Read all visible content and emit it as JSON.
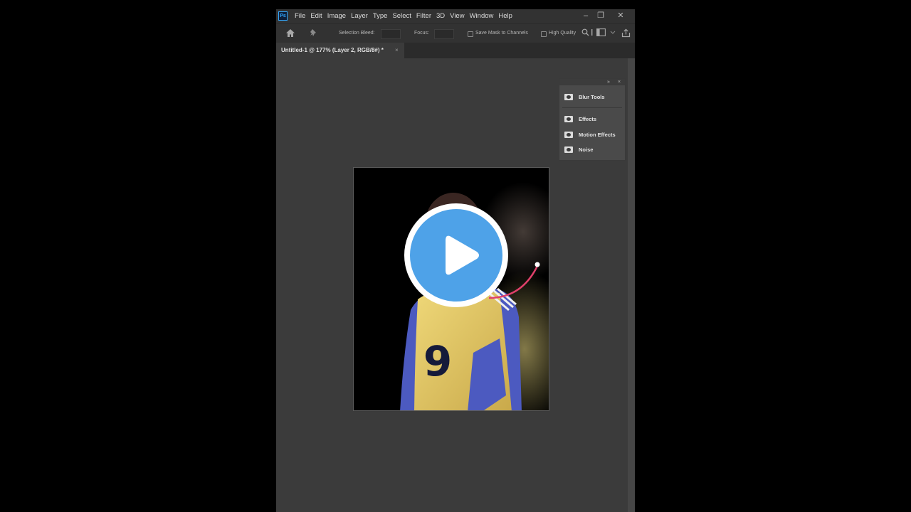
{
  "app": {
    "logo_text": "Ps",
    "menu": [
      "File",
      "Edit",
      "Image",
      "Layer",
      "Type",
      "Select",
      "Filter",
      "3D",
      "View",
      "Window",
      "Help"
    ],
    "window_controls": {
      "minimize": "–",
      "restore": "❐",
      "close": "✕"
    }
  },
  "options_bar": {
    "selection_bleed_label": "Selection Bleed:",
    "focus_label": "Focus:",
    "save_mask_label": "Save Mask to Channels",
    "high_quality_label": "High Quality"
  },
  "document_tab": {
    "title": "Untitled-1 @ 177% (Layer 2, RGB/8#) *",
    "close": "×"
  },
  "blur_panel": {
    "collapse": "»",
    "close": "×",
    "items": [
      "Blur Tools",
      "Effects",
      "Motion Effects",
      "Noise"
    ]
  },
  "canvas": {
    "jersey_number": "9"
  }
}
